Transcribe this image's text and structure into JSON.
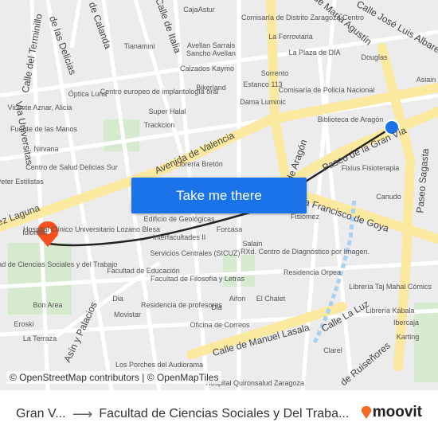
{
  "map": {
    "labels": [
      "CajaAstur",
      "Comisaría de Distrito Zaragoza Centro",
      "La Ferroviaria",
      "La Plaza de DIA",
      "Douglas",
      "Asiain",
      "Tianamini",
      "Avellan Sarrais",
      "Sancho Avellan",
      "Calzados Kaymo",
      "Sorrento",
      "Óptica Luna",
      "Centro europeo de implantología oral",
      "Bikerland",
      "Estanco 113",
      "Comisaría de Policía Nacional",
      "Vicente Aznar, Alicia",
      "Super Halal",
      "Dama Luminic",
      "Biblioteca de Aragón",
      "Fuente de las Manos",
      "Trackcion",
      "Nirvana",
      "Fixius Fisioterapia",
      "Centro de Salud Delicias Sur",
      "Librería Bretón",
      "Peter Estilistas",
      "Canudo",
      "Hospital Clínico Universitario Lozano Blesa",
      "Edificio de Geológicas",
      "Fisiomez",
      "Forcasa",
      "Interfacultades II",
      "Salain",
      "RXd. Centro de Diagnóstico por Imagen.",
      "Idiomas",
      "Facultad de Ciencias Sociales y del Trabajo",
      "Servicios Centrales (SICUZ)",
      "Facultad de Educación",
      "Facultad de Filosofía y Letras",
      "Residencia Orpea",
      "Librería Taj Mahal Cómics",
      "Bon Area",
      "Dia",
      "Movistar",
      "Residencia de profesores",
      "Aifon",
      "El Chalet",
      "Librería Kábala",
      "Eroski",
      "Dia",
      "Ibercaja",
      "La Terraza",
      "Oficina de Correos",
      "Karting",
      "Clarel",
      "Los Porches del Audiorama",
      "Hospital Quironsalud Zaragoza"
    ],
    "streets": [
      "Calle José Luis Albareda",
      "de María Agustín",
      "Calle del Terminillo",
      "de las Delicias",
      "de Calanda",
      "Calle de Italia",
      "Vía Universitas",
      "Avenida de Valencia",
      "Paseo de la Gran Vía",
      "Paseo Sagasta",
      "des de Aragón",
      "Avda Francisco de Goya",
      "ez Laguna",
      "Asín y Palacios",
      "Calle La Luz",
      "Calle de Manuel Lasala",
      "de Ruiseñores"
    ],
    "origin_marker_color": "#1a73e8",
    "destination_marker_color": "#f4511e",
    "route_color": "#222222"
  },
  "cta": {
    "label": "Take me there"
  },
  "attribution": "© OpenStreetMap contributors | © OpenMapTiles",
  "footer": {
    "from": "Gran V...",
    "arrow_icon": "arrow-right-icon",
    "to": "Facultad de Ciencias Sociales y Del Traba...",
    "brand": "moovit",
    "brand_color": "#f26b21"
  }
}
